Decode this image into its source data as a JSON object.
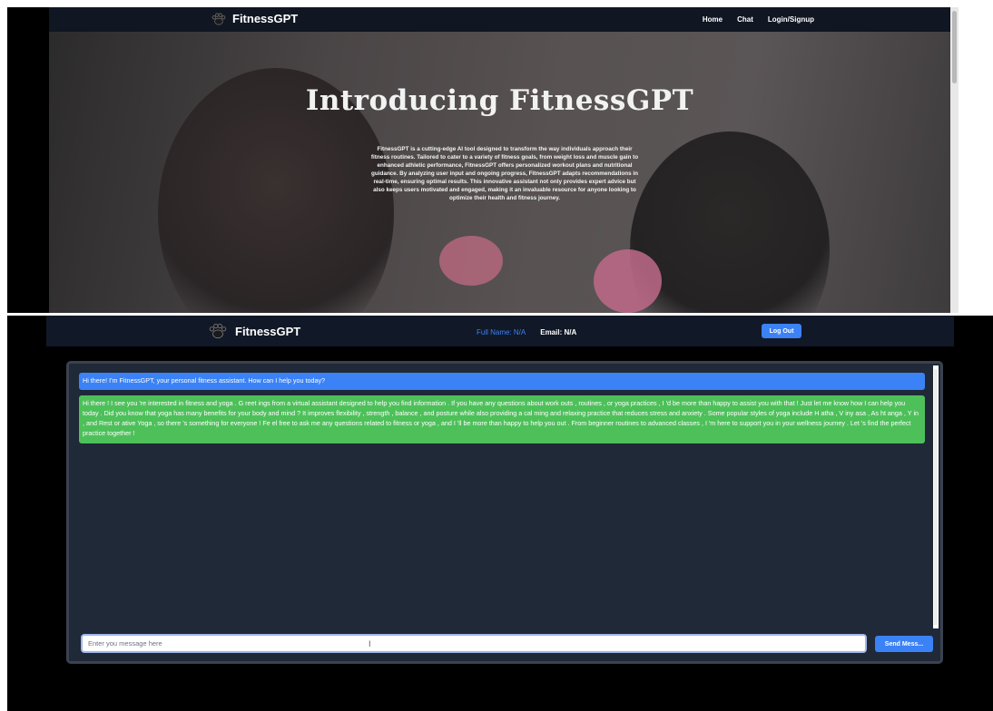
{
  "landing": {
    "brand": "FitnessGPT",
    "nav": {
      "home": "Home",
      "chat": "Chat",
      "login": "Login/Signup"
    },
    "hero_title": "Introducing FitnessGPT",
    "hero_description": "FitnessGPT is a cutting-edge AI tool designed to transform the way individuals approach their fitness routines. Tailored to cater to a variety of fitness goals, from weight loss and muscle gain to enhanced athletic performance, FitnessGPT offers personalized workout plans and nutritional guidance. By analyzing user input and ongoing progress, FitnessGPT adapts recommendations in real-time, ensuring optimal results. This innovative assistant not only provides expert advice but also keeps users motivated and engaged, making it an invaluable resource for anyone looking to optimize their health and fitness journey."
  },
  "chat_page": {
    "brand": "FitnessGPT",
    "full_name_label": "Full Name: N/A",
    "email_label": "Email: N/A",
    "logout_label": "Log Out",
    "messages": [
      {
        "role": "assistant-greeting",
        "text": "Hi there! I'm FitnessGPT, your personal fitness assistant. How can I help you today?"
      },
      {
        "role": "assistant-reply",
        "text": "Hi there ! I see you 're interested in fitness and yoga . G reet ings from a virtual assistant designed to help you find information . If you have any questions about work outs , routines , or yoga practices , I 'd be more than happy to assist you with that ! Just let me know how I can help you today . Did you know that yoga has many benefits for your body and mind ? It improves flexibility , strength , balance , and posture while also providing a cal ming and relaxing practice that reduces stress and anxiety . Some popular styles of yoga include H atha , V iny asa , As ht anga , Y in , and Rest or ative Yoga , so there 's something for everyone ! Fe el free to ask me any questions related to fitness or yoga , and I 'll be more than happy to help you out . From beginner routines to advanced classes , I 'm here to support you in your wellness journey . Let 's find the perfect practice together !"
      }
    ],
    "input_placeholder": "Enter you message here",
    "send_label": "Send Mess..."
  },
  "colors": {
    "nav_bg": "#111827",
    "panel_bg": "#1f2937",
    "accent_blue": "#3b82f6",
    "reply_green": "#4ec05a"
  }
}
